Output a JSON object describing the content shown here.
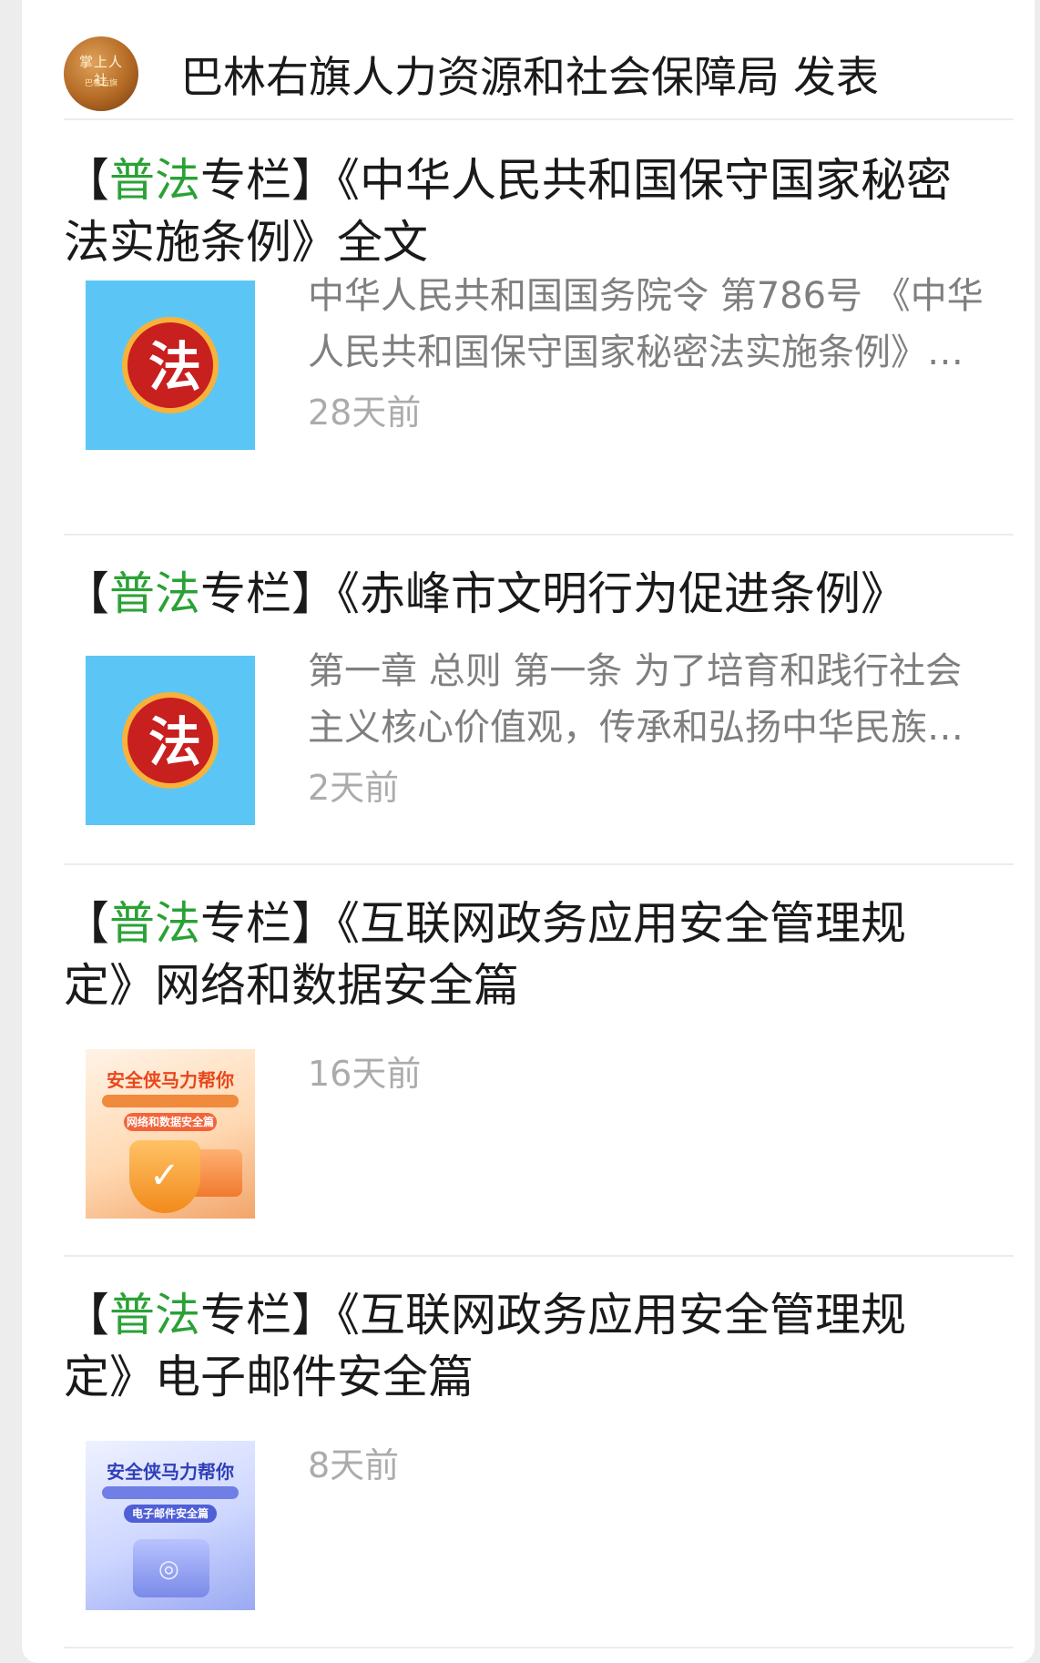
{
  "header": {
    "avatar_text": "掌上人社",
    "avatar_sub": "巴林右旗",
    "publisher": "巴林右旗人力资源和社会保障局 发表"
  },
  "articles": [
    {
      "title_prefix": "【",
      "title_highlight": "普法",
      "title_rest_line1": "专栏】《中华人民共和国保守国家秘密",
      "title_line2": "法实施条例》全文",
      "desc_line1": "中华人民共和国国务院令 第786号 《中华",
      "desc_line2": "人民共和国保守国家秘密法实施条例》…",
      "time": "28天前",
      "thumb_icon": "law-logo-icon",
      "thumb_glyph": "法"
    },
    {
      "title_prefix": "【",
      "title_highlight": "普法",
      "title_rest_line1": "专栏】《赤峰市文明行为促进条例》",
      "desc_line1": "第一章 总则 第一条 为了培育和践行社会",
      "desc_line2": "主义核心价值观，传承和弘扬中华民族…",
      "time": "2天前",
      "thumb_icon": "law-logo-icon",
      "thumb_glyph": "法"
    },
    {
      "title_prefix": "【",
      "title_highlight": "普法",
      "title_rest_line1": "专栏】《互联网政务应用安全管理规",
      "title_line2": "定》网络和数据安全篇",
      "time": "16天前",
      "thumb_title": "安全侠马力帮你",
      "thumb_pill": "网络和数据安全篇",
      "thumb_icon": "shield-check-icon"
    },
    {
      "title_prefix": "【",
      "title_highlight": "普法",
      "title_rest_line1": "专栏】《互联网政务应用安全管理规",
      "title_line2": "定》电子邮件安全篇",
      "time": "8天前",
      "thumb_title": "安全侠马力帮你",
      "thumb_pill": "电子邮件安全篇",
      "thumb_icon": "safe-lock-icon"
    }
  ],
  "colors": {
    "highlight": "#2aa136",
    "law_bg": "#5bc6f5",
    "law_circle": "#c81f1f"
  }
}
